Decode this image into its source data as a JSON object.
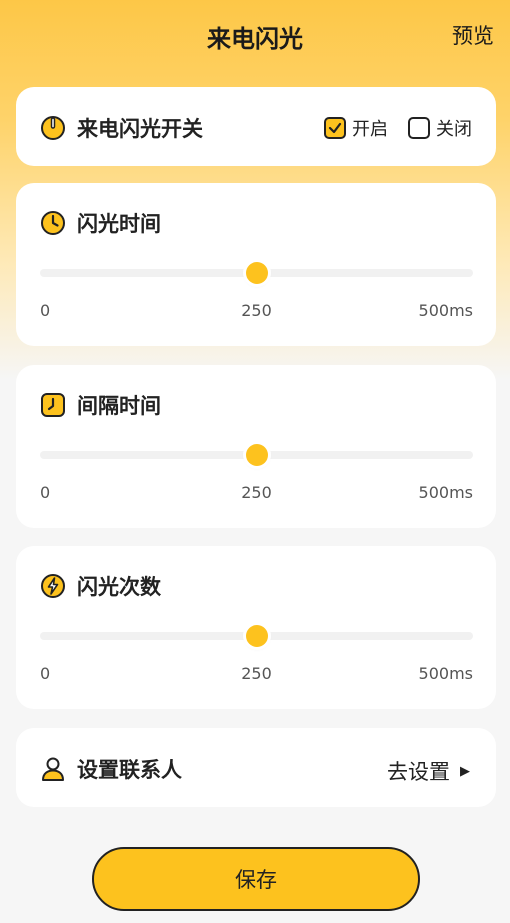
{
  "header": {
    "title": "来电闪光",
    "preview_label": "预览"
  },
  "colors": {
    "accent": "#FDC21E",
    "track": "#F1F1F1",
    "text": "#222222"
  },
  "switch_card": {
    "icon": "power-icon",
    "label": "来电闪光开关",
    "options": [
      {
        "label": "开启",
        "checked": true
      },
      {
        "label": "关闭",
        "checked": false
      }
    ]
  },
  "sliders": [
    {
      "icon": "clock-icon",
      "label": "闪光时间",
      "value": 250,
      "min_label": "0",
      "mid_label": "250",
      "max_label": "500ms",
      "max": 500
    },
    {
      "icon": "timer-square-icon",
      "label": "间隔时间",
      "value": 250,
      "min_label": "0",
      "mid_label": "250",
      "max_label": "500ms",
      "max": 500
    },
    {
      "icon": "lightning-icon",
      "label": "闪光次数",
      "value": 250,
      "min_label": "0",
      "mid_label": "250",
      "max_label": "500ms",
      "max": 500
    }
  ],
  "contact_card": {
    "icon": "person-icon",
    "label": "设置联系人",
    "action_label": "去设置",
    "arrow": "▶"
  },
  "save_label": "保存"
}
